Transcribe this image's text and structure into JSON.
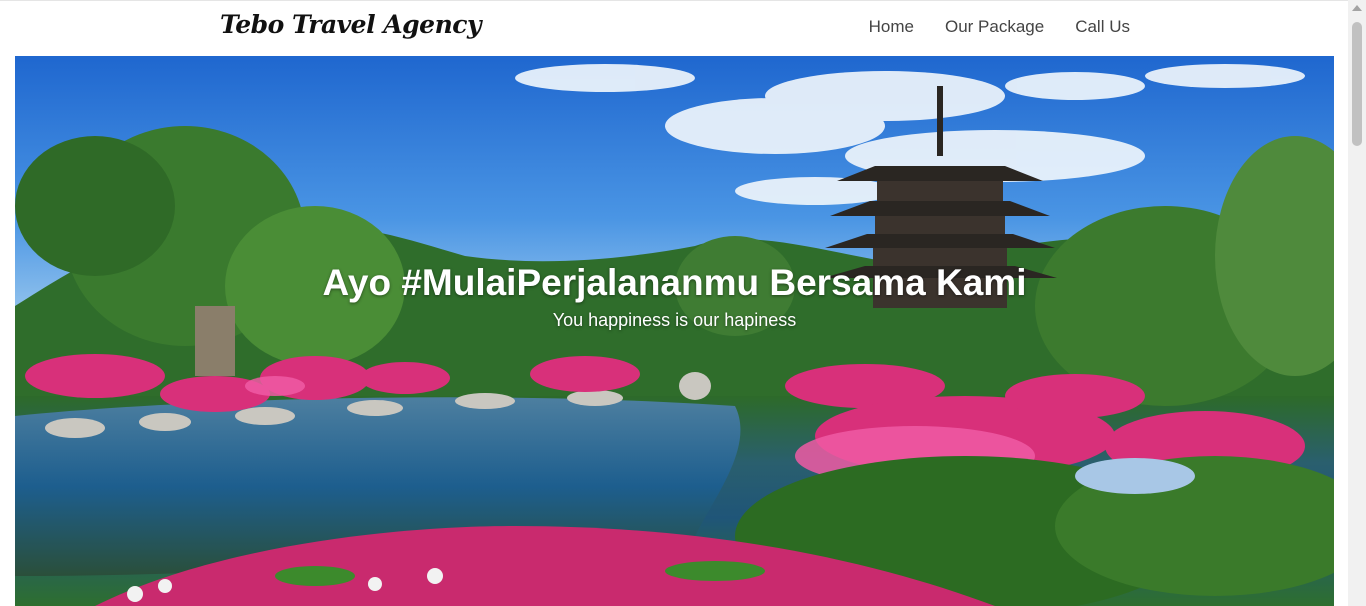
{
  "navbar": {
    "brand": "Tebo Travel Agency",
    "links": [
      "Home",
      "Our Package",
      "Call Us"
    ]
  },
  "hero": {
    "title": "Ayo #MulaiPerjalananmu Bersama Kami",
    "subtitle": "You happiness is our hapiness",
    "image": "japanese-garden-pagoda-image"
  },
  "colors": {
    "text_dark": "#111111",
    "nav_text": "#444444",
    "hero_text": "#ffffff",
    "sky": "#3d8be6",
    "foliage": "#2d6a2a",
    "flowers": "#d8307a"
  }
}
